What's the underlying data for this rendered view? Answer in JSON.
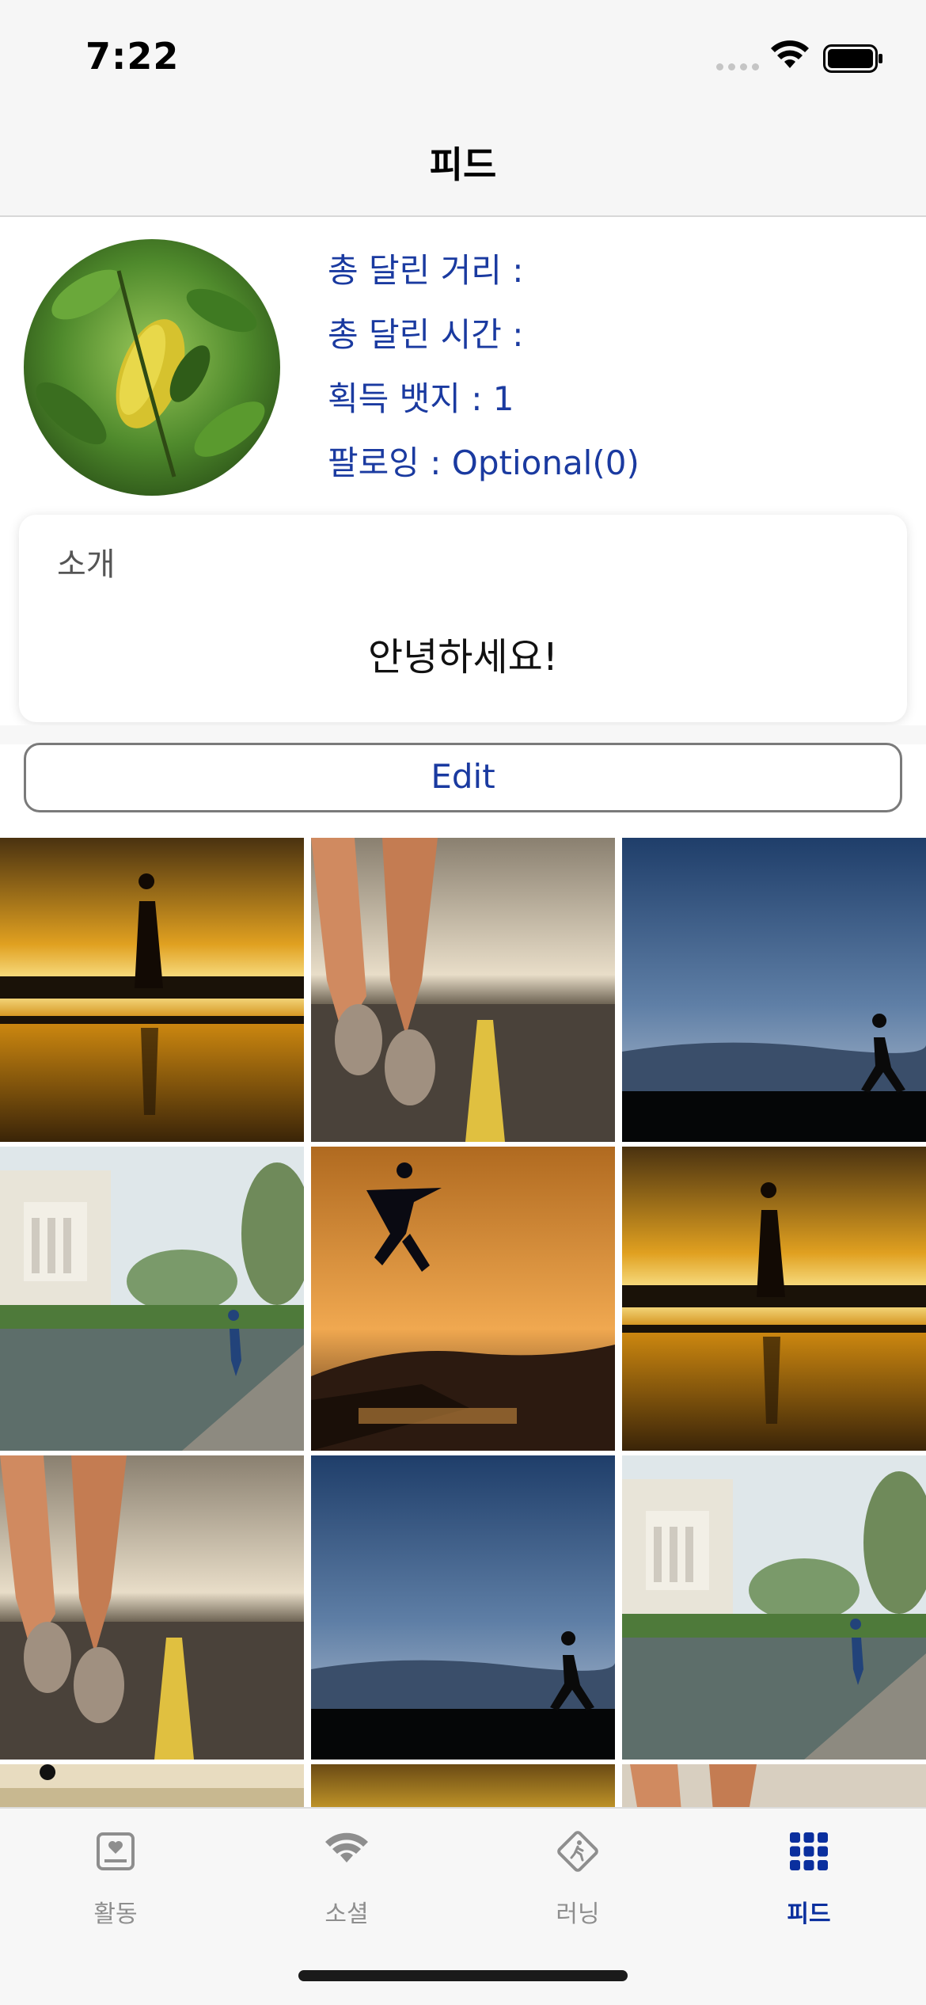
{
  "status_bar": {
    "time": "7:22"
  },
  "nav": {
    "title": "피드"
  },
  "profile": {
    "stats": [
      "총 달린 거리 :",
      "총 달린 시간 :",
      "획득 뱃지 : 1",
      "팔로잉 : Optional(0)"
    ]
  },
  "intro": {
    "label": "소개",
    "text": "안녕하세요!"
  },
  "edit_button": {
    "label": "Edit"
  },
  "tabs": [
    {
      "label": "활동",
      "icon": "activity-card-icon"
    },
    {
      "label": "소셜",
      "icon": "wifi-icon"
    },
    {
      "label": "러닝",
      "icon": "running-sign-icon"
    },
    {
      "label": "피드",
      "icon": "grid-icon"
    }
  ],
  "colors": {
    "accent": "#1a3aa0",
    "active_tab": "#0a2f9e"
  }
}
